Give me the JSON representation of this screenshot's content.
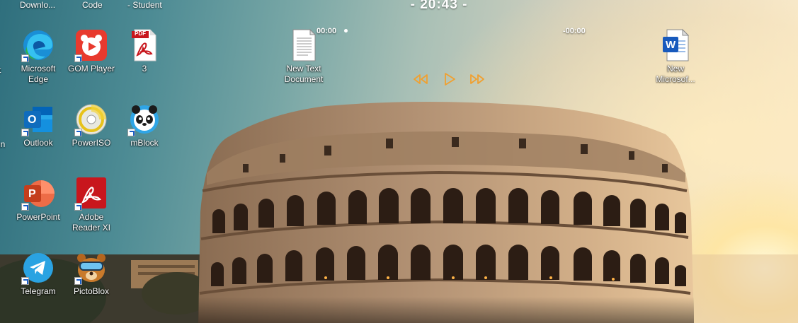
{
  "top_partial_labels": [
    "Downlo...",
    "Code",
    "- Student"
  ],
  "left_edge_labels": [
    "t",
    "in"
  ],
  "clock": {
    "time": "- 20:43 -"
  },
  "media": {
    "elapsed": "00:00",
    "remaining": "-00:00",
    "progress": 0
  },
  "icons": [
    {
      "id": "edge",
      "label": "Microsoft Edge",
      "icon": "edge-icon"
    },
    {
      "id": "gom",
      "label": "GOM Player",
      "icon": "gom-player-icon"
    },
    {
      "id": "pdf3",
      "label": "3",
      "icon": "pdf-file-icon",
      "badge": "PDF"
    },
    {
      "id": "outlook",
      "label": "Outlook",
      "icon": "outlook-icon",
      "letter": "O"
    },
    {
      "id": "poweriso",
      "label": "PowerISO",
      "icon": "poweriso-icon"
    },
    {
      "id": "mblock",
      "label": "mBlock",
      "icon": "mblock-icon"
    },
    {
      "id": "powerpoint",
      "label": "PowerPoint",
      "icon": "powerpoint-icon",
      "letter": "P"
    },
    {
      "id": "adobe",
      "label": "Adobe Reader XI",
      "icon": "adobe-reader-icon"
    },
    {
      "id": "telegram",
      "label": "Telegram",
      "icon": "telegram-icon"
    },
    {
      "id": "pictoblox",
      "label": "PictoBlox",
      "icon": "pictoblox-icon"
    },
    {
      "id": "newtext",
      "label": "New Text Document",
      "icon": "text-document-icon"
    },
    {
      "id": "newword",
      "label": "New Microsof...",
      "icon": "word-document-icon",
      "letter": "W"
    }
  ],
  "colors": {
    "media_controls": "#f0a030",
    "edge": "#1a8fd6",
    "outlook": "#0f6cbd",
    "powerpoint": "#d24726",
    "adobe": "#c8161d",
    "telegram": "#2aa3e2",
    "word": "#185abd"
  }
}
